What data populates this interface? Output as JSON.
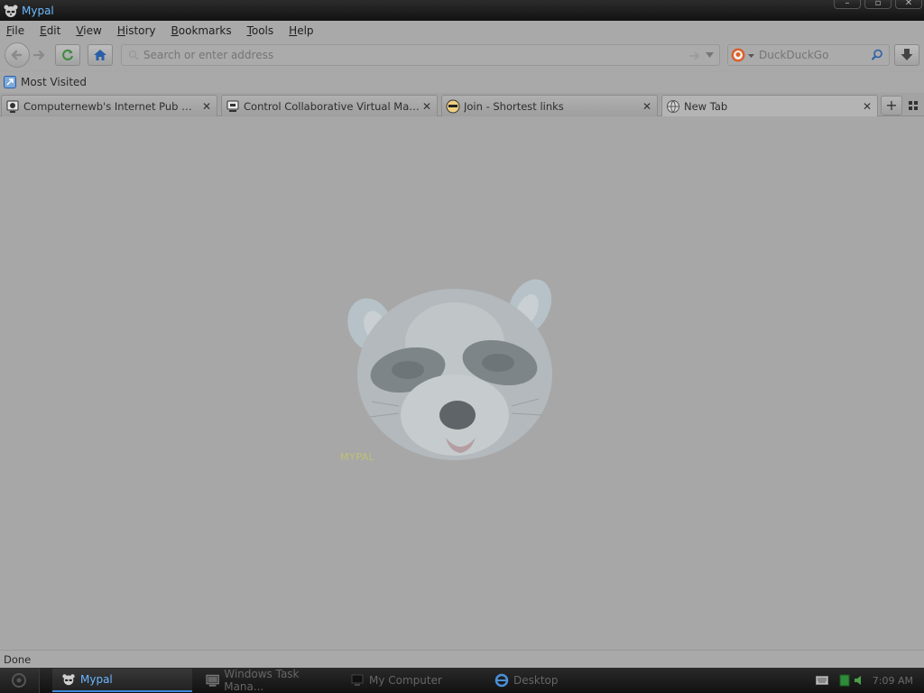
{
  "window": {
    "title": "Mypal"
  },
  "menu": {
    "items": [
      "File",
      "Edit",
      "View",
      "History",
      "Bookmarks",
      "Tools",
      "Help"
    ]
  },
  "navbar": {
    "url_placeholder": "Search or enter address",
    "search_engine": "DuckDuckGo"
  },
  "bookmarks": {
    "most_visited": "Most Visited"
  },
  "tabs": [
    {
      "label": "Computernewb's Internet Pub Hub",
      "active": false
    },
    {
      "label": "Control Collaborative Virtual Mach...",
      "active": false
    },
    {
      "label": "Join - Shortest links",
      "active": false
    },
    {
      "label": "New Tab",
      "active": true
    }
  ],
  "content": {
    "caption": "MYPAL"
  },
  "status": {
    "text": "Done"
  },
  "taskbar": {
    "items": [
      {
        "label": "Mypal",
        "active": true
      },
      {
        "label": "Windows Task Mana...",
        "active": false
      },
      {
        "label": "My Computer",
        "active": false
      },
      {
        "label": "Desktop",
        "active": false
      }
    ],
    "clock": "7:09 AM"
  },
  "colors": {
    "accent": "#6ab6ff",
    "background": "#a7a7a7"
  }
}
